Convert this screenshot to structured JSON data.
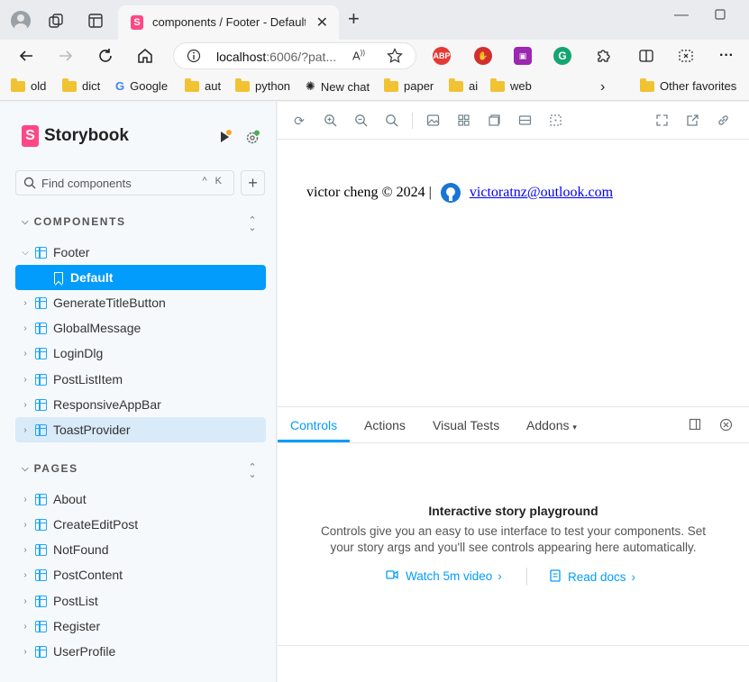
{
  "browser": {
    "tab_title": "components / Footer - Default - Storybook",
    "address": {
      "host": "localhost",
      "path": ":6006/?pat..."
    },
    "bookmarks": [
      {
        "label": "old",
        "icon": "folder-icon"
      },
      {
        "label": "dict",
        "icon": "folder-icon"
      },
      {
        "label": "Google",
        "icon": "google-icon"
      },
      {
        "label": "aut",
        "icon": "folder-icon"
      },
      {
        "label": "python",
        "icon": "folder-icon"
      },
      {
        "label": "New chat",
        "icon": "openai-icon"
      },
      {
        "label": "paper",
        "icon": "folder-icon"
      },
      {
        "label": "ai",
        "icon": "folder-icon"
      },
      {
        "label": "web",
        "icon": "folder-icon"
      }
    ],
    "other_favorites": "Other favorites",
    "extensions": {
      "abp": "ABP"
    }
  },
  "storybook": {
    "brand": "Storybook",
    "search_placeholder": "Find components",
    "search_shortcut": "^ K",
    "components_header": "COMPONENTS",
    "components": [
      {
        "label": "Footer",
        "expanded": true
      },
      {
        "label": "Default",
        "story": true,
        "selected": true
      },
      {
        "label": "GenerateTitleButton"
      },
      {
        "label": "GlobalMessage"
      },
      {
        "label": "LoginDlg"
      },
      {
        "label": "PostListItem"
      },
      {
        "label": "ResponsiveAppBar"
      },
      {
        "label": "ToastProvider",
        "hover": true
      }
    ],
    "pages_header": "PAGES",
    "pages": [
      {
        "label": "About"
      },
      {
        "label": "CreateEditPost"
      },
      {
        "label": "NotFound"
      },
      {
        "label": "PostContent"
      },
      {
        "label": "PostList"
      },
      {
        "label": "Register"
      },
      {
        "label": "UserProfile"
      }
    ]
  },
  "preview": {
    "copyright": "victor cheng © 2024 |",
    "email": "victoratnz@outlook.com"
  },
  "panel": {
    "tabs": [
      "Controls",
      "Actions",
      "Visual Tests",
      "Addons"
    ],
    "active_tab": "Controls",
    "empty_title": "Interactive story playground",
    "empty_desc": "Controls give you an easy to use interface to test your components. Set your story args and you'll see controls appearing here automatically.",
    "watch_link": "Watch 5m video",
    "docs_link": "Read docs"
  },
  "colors": {
    "accent": "#029cfd",
    "brand": "#ff4785",
    "sidebar_bg": "#f6f9fc"
  }
}
